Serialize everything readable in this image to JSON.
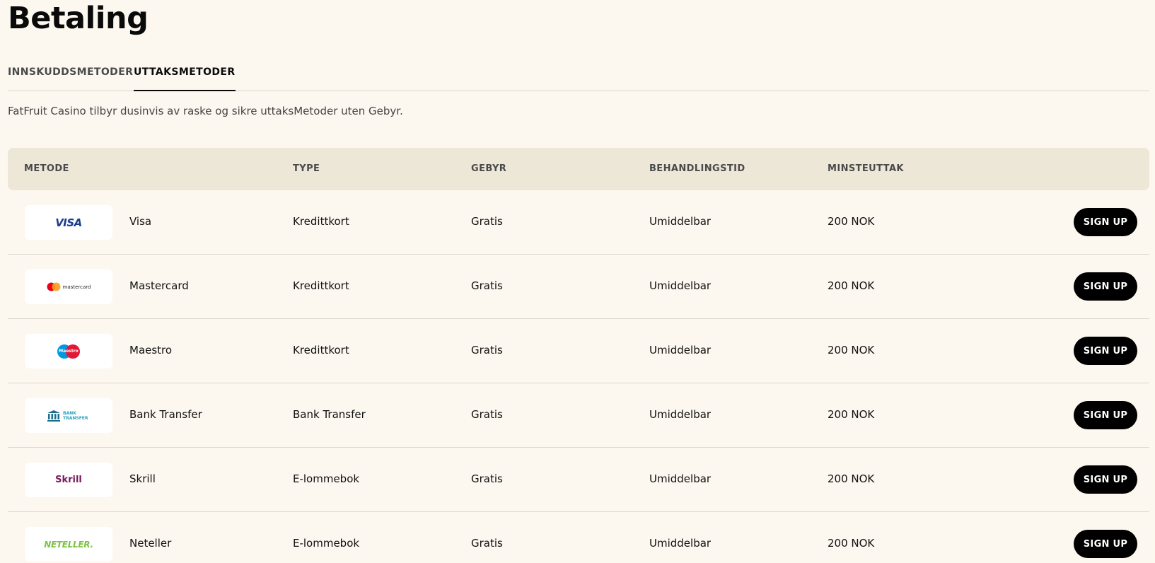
{
  "page": {
    "title": "Betaling",
    "intro": "FatFruit Casino tilbyr dusinvis av raske og sikre uttaksMetoder uten Gebyr."
  },
  "tabs": [
    {
      "label": "INNSKUDDSMETODER",
      "active": false
    },
    {
      "label": "UTTAKSMETODER",
      "active": true
    }
  ],
  "table": {
    "headers": {
      "method": "METODE",
      "type": "TYPE",
      "fee": "GEBYR",
      "time": "BEHANDLINGSTID",
      "min": "MINSTEUTTAK"
    },
    "signup_label": "SIGN UP",
    "rows": [
      {
        "name": "Visa",
        "logo": "visa-logo",
        "logo_text": "VISA",
        "type": "Kredittkort",
        "fee": "Gratis",
        "time": "Umiddelbar",
        "min": "200 NOK"
      },
      {
        "name": "Mastercard",
        "logo": "mastercard-logo",
        "logo_text": "mastercard",
        "type": "Kredittkort",
        "fee": "Gratis",
        "time": "Umiddelbar",
        "min": "200 NOK"
      },
      {
        "name": "Maestro",
        "logo": "maestro-logo",
        "logo_text": "Maestro",
        "type": "Kredittkort",
        "fee": "Gratis",
        "time": "Umiddelbar",
        "min": "200 NOK"
      },
      {
        "name": "Bank Transfer",
        "logo": "bank-transfer-logo",
        "logo_text": "BANK TRANSFER",
        "type": "Bank Transfer",
        "fee": "Gratis",
        "time": "Umiddelbar",
        "min": "200 NOK"
      },
      {
        "name": "Skrill",
        "logo": "skrill-logo",
        "logo_text": "Skrill",
        "type": "E-lommebok",
        "fee": "Gratis",
        "time": "Umiddelbar",
        "min": "200 NOK"
      },
      {
        "name": "Neteller",
        "logo": "neteller-logo",
        "logo_text": "NETELLER.",
        "type": "E-lommebok",
        "fee": "Gratis",
        "time": "Umiddelbar",
        "min": "200 NOK"
      }
    ]
  },
  "colors": {
    "background": "#fcf7ef",
    "header_background": "#ede7d8",
    "button": "#000000",
    "button_text": "#ffffff"
  }
}
